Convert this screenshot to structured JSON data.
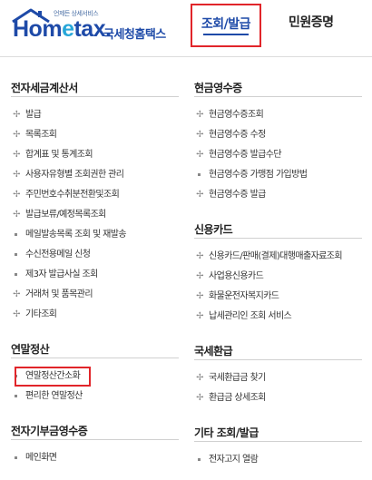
{
  "header": {
    "logo_tagline": "언제든 상세서비스",
    "logo_word_a": "Hom",
    "logo_word_b": "e",
    "logo_word_c": "tax.",
    "logo_sub": "국세청홈택스",
    "tabs": [
      {
        "label": "조회/발급",
        "active": true
      },
      {
        "label": "민원증명",
        "active": false
      }
    ]
  },
  "left": {
    "sections": [
      {
        "title": "전자세금계산서",
        "items": [
          "발급",
          "목록조회",
          "합계표 및 통계조회",
          "사용자유형별 조회권한 관리",
          "주민번호수취분전환및조회",
          "발급보류/예정목록조회",
          "메일발송목록 조회 및 재발송",
          "수신전용메일 신청",
          "제3자 발급사실 조회",
          "거래처 및 품목관리",
          "기타조회"
        ]
      },
      {
        "title": "연말정산",
        "items": [
          "연말정산간소화",
          "편리한 연말정산"
        ]
      },
      {
        "title": "전자기부금영수증",
        "items": [
          "메인화면"
        ]
      }
    ]
  },
  "right": {
    "sections": [
      {
        "title": "현금영수증",
        "items": [
          "현금영수증조회",
          "현금영수증 수정",
          "현금영수증 발급수단",
          "현금영수증 가맹점 가입방법",
          "현금영수증 발급"
        ]
      },
      {
        "title": "신용카드",
        "items": [
          "신용카드/판매(결제)대행매출자료조회",
          "사업용신용카드",
          "화물운전자복지카드",
          "납세관리인 조회 서비스"
        ]
      },
      {
        "title": "국세환급",
        "items": [
          "국세환급금 찾기",
          "환급금 상세조회"
        ]
      },
      {
        "title": "기타 조회/발급",
        "items": [
          "전자고지 열람"
        ]
      }
    ]
  },
  "colors": {
    "brand": "#1e4aa8",
    "accent": "#27a7d9",
    "highlight": "#e1252a"
  }
}
